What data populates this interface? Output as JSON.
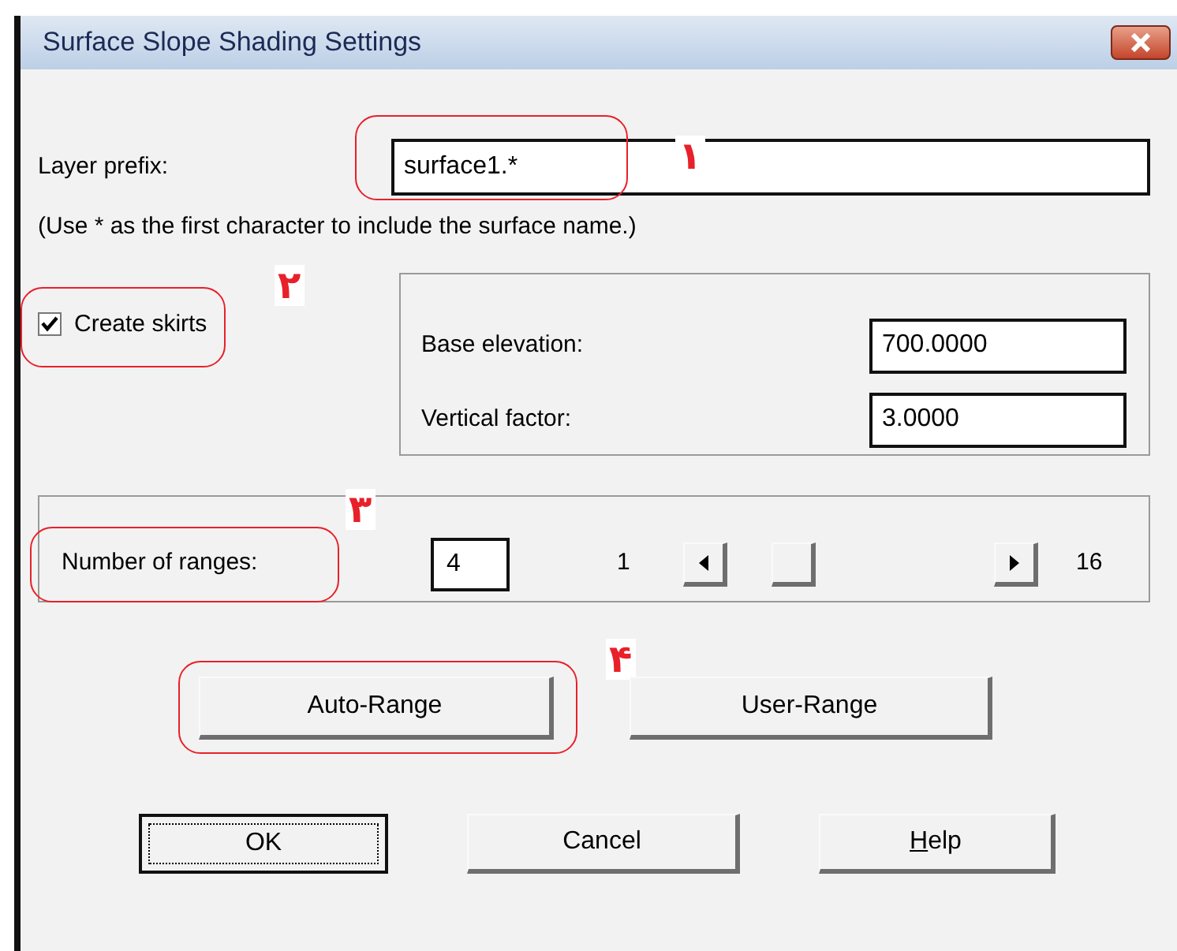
{
  "window": {
    "title": "Surface Slope Shading Settings"
  },
  "layer_prefix": {
    "label": "Layer prefix:",
    "value": "surface1.*",
    "annotation": "١"
  },
  "hint": "(Use * as the first character to include the surface name.)",
  "create_skirts": {
    "label": "Create skirts",
    "checked": true,
    "annotation": "٢"
  },
  "skirt_fields": [
    {
      "label": "Base elevation:",
      "value": "700.0000"
    },
    {
      "label": "Vertical factor:",
      "value": "3.0000"
    }
  ],
  "ranges": {
    "label": "Number of ranges:",
    "value": "4",
    "annotation": "٣",
    "min_label": "1",
    "max_label": "16",
    "level": 0.2
  },
  "range_buttons": [
    {
      "label": "Auto-Range",
      "annotation": "۴"
    },
    {
      "label": "User-Range"
    }
  ],
  "buttons": [
    {
      "label": "OK",
      "default": true,
      "underline_first": false
    },
    {
      "label": "Cancel",
      "default": false,
      "underline_first": false
    },
    {
      "label": "Help",
      "default": false,
      "underline_first": true
    }
  ]
}
